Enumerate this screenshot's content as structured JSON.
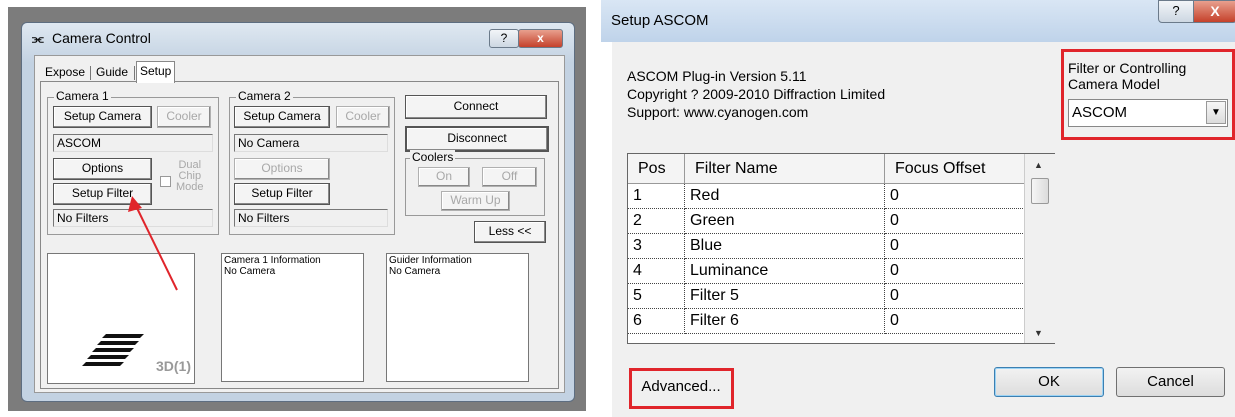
{
  "camera_control": {
    "title": "Camera Control",
    "title_icon": "⫘",
    "help_label": "?",
    "close_label": "x",
    "tabs": [
      "Expose",
      "Guide",
      "Setup"
    ],
    "camera1": {
      "legend": "Camera 1",
      "setup_camera": "Setup Camera",
      "cooler": "Cooler",
      "status": "ASCOM",
      "options": "Options",
      "dual_chip_mode": [
        "Dual",
        "Chip",
        "Mode"
      ],
      "setup_filter": "Setup Filter",
      "filters": "No Filters"
    },
    "camera2": {
      "legend": "Camera 2",
      "setup_camera": "Setup Camera",
      "cooler": "Cooler",
      "status": "No Camera",
      "options": "Options",
      "setup_filter": "Setup Filter",
      "filters": "No Filters"
    },
    "connect": "Connect",
    "disconnect": "Disconnect",
    "coolers": {
      "legend": "Coolers",
      "on": "On",
      "off": "Off",
      "warm_up": "Warm Up"
    },
    "less": "Less <<",
    "logo_label": "3D(1)",
    "camera1_info": {
      "title": "Camera 1 Information",
      "text": "No Camera"
    },
    "guider_info": {
      "title": "Guider Information",
      "text": "No Camera"
    }
  },
  "setup_ascom": {
    "title": "Setup ASCOM",
    "help_label": "?",
    "close_label": "X",
    "plugin_version": "ASCOM Plug-in Version 5.11",
    "copyright": "Copyright ? 2009-2010 Diffraction Limited",
    "support": "Support: www.cyanogen.com",
    "model_label": [
      "Filter or Controlling",
      "Camera Model"
    ],
    "model_value": "ASCOM",
    "table": {
      "headers": [
        "Pos",
        "Filter Name",
        "Focus Offset"
      ],
      "rows": [
        [
          "1",
          "Red",
          "0"
        ],
        [
          "2",
          "Green",
          "0"
        ],
        [
          "3",
          "Blue",
          "0"
        ],
        [
          "4",
          "Luminance",
          "0"
        ],
        [
          "5",
          "Filter 5",
          "0"
        ],
        [
          "6",
          "Filter 6",
          "0"
        ]
      ]
    },
    "advanced": "Advanced...",
    "ok": "OK",
    "cancel": "Cancel"
  },
  "colors": {
    "highlight": "#e0252b",
    "arrow": "#e0252b"
  }
}
